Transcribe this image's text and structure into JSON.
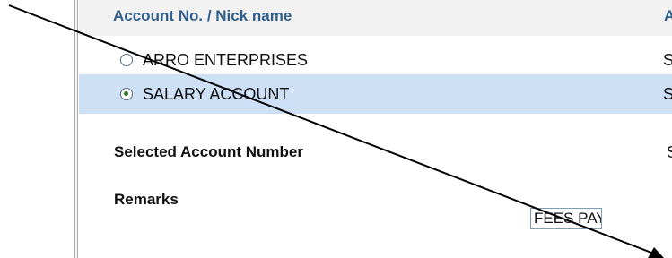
{
  "table": {
    "header_account": "Account No. / Nick name",
    "header_type": "Ac",
    "rows": [
      {
        "label": "ARRO ENTERPRISES",
        "type": "Sa",
        "selected": false
      },
      {
        "label": "SALARY ACCOUNT",
        "type": "Sa",
        "selected": true
      }
    ]
  },
  "form": {
    "selected_label": "Selected Account Number",
    "selected_value": "SA",
    "remarks_label": "Remarks",
    "remarks_value": "FEES PAYM"
  },
  "colors": {
    "header_text": "#2f5f8a",
    "selected_row_bg": "#cde0f5",
    "arrow": "#000000"
  }
}
